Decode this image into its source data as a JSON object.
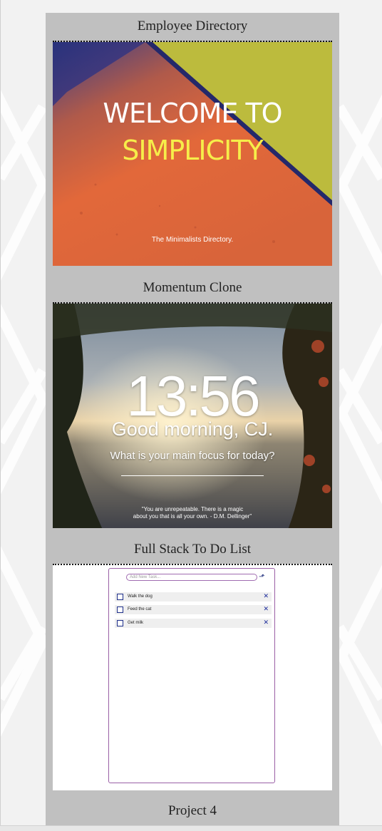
{
  "projects": [
    {
      "title": "Employee Directory"
    },
    {
      "title": "Momentum Clone"
    },
    {
      "title": "Full Stack To Do List"
    },
    {
      "title": "Project 4"
    }
  ],
  "employee_directory": {
    "welcome": "WELCOME TO",
    "simplicity": "SIMPLICITY",
    "tagline": "The Minimalists Directory."
  },
  "momentum": {
    "time": "13:56",
    "greeting": "Good morning, CJ.",
    "focus_prompt": "What is your main focus for today?",
    "quote_line1": "\"You are unrepeatable.  There is a magic",
    "quote_line2": "about you that is all your own. - D.M. Dellinger\""
  },
  "todo": {
    "input_placeholder": "Add New Task...",
    "tasks": [
      {
        "label": "Walk the dog",
        "done": false
      },
      {
        "label": "Feed the cat",
        "done": false
      },
      {
        "label": "Get milk",
        "done": false
      }
    ]
  },
  "colors": {
    "panel": "#c0c0c0",
    "simplicity_yellow": "#f6ee4a",
    "todo_border": "#9a5fa6",
    "todo_accent": "#1a2a9a"
  }
}
